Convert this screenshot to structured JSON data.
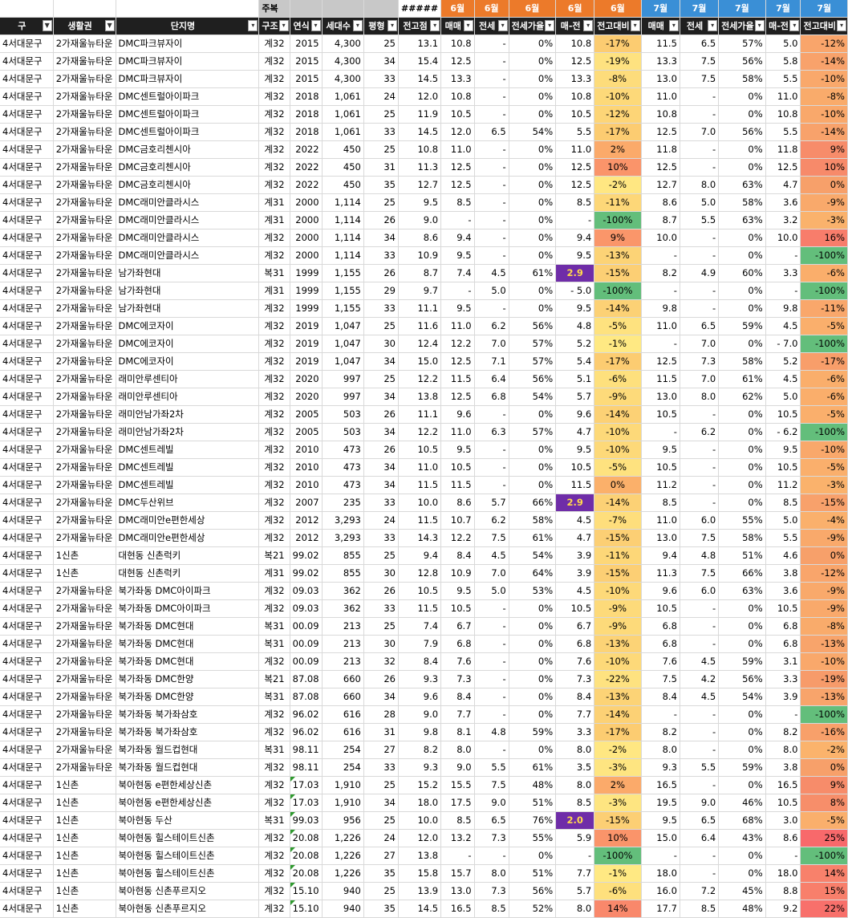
{
  "top_row": {
    "label": "주복",
    "hash": "#####",
    "months6": [
      "6월",
      "6월",
      "6월",
      "6월",
      "6월"
    ],
    "months7": [
      "7월",
      "7월",
      "7월",
      "7월",
      "7월"
    ]
  },
  "headers": [
    "구",
    "생활권",
    "단지명",
    "구조",
    "연식",
    "세대수",
    "평형",
    "전고점",
    "매매",
    "전세",
    "전세가율",
    "매-전",
    "전고대비",
    "매매",
    "전세",
    "전세가율",
    "매-전",
    "전고대비"
  ],
  "rows": [
    [
      "4서대문구",
      "2가재울뉴타운",
      "DMC파크뷰자이",
      "계32",
      "2015",
      "4,300",
      "25",
      "13.1",
      "10.8",
      "-",
      "0%",
      "10.8",
      "-17%",
      "11.5",
      "6.5",
      "57%",
      "5.0",
      "-12%"
    ],
    [
      "4서대문구",
      "2가재울뉴타운",
      "DMC파크뷰자이",
      "계32",
      "2015",
      "4,300",
      "34",
      "15.4",
      "12.5",
      "-",
      "0%",
      "12.5",
      "-19%",
      "13.3",
      "7.5",
      "56%",
      "5.8",
      "-14%"
    ],
    [
      "4서대문구",
      "2가재울뉴타운",
      "DMC파크뷰자이",
      "계32",
      "2015",
      "4,300",
      "33",
      "14.5",
      "13.3",
      "-",
      "0%",
      "13.3",
      "-8%",
      "13.0",
      "7.5",
      "58%",
      "5.5",
      "-10%"
    ],
    [
      "4서대문구",
      "2가재울뉴타운",
      "DMC센트럴아이파크",
      "계32",
      "2018",
      "1,061",
      "24",
      "12.0",
      "10.8",
      "-",
      "0%",
      "10.8",
      "-10%",
      "11.0",
      "-",
      "0%",
      "11.0",
      "-8%"
    ],
    [
      "4서대문구",
      "2가재울뉴타운",
      "DMC센트럴아이파크",
      "계32",
      "2018",
      "1,061",
      "25",
      "11.9",
      "10.5",
      "-",
      "0%",
      "10.5",
      "-12%",
      "10.8",
      "-",
      "0%",
      "10.8",
      "-10%"
    ],
    [
      "4서대문구",
      "2가재울뉴타운",
      "DMC센트럴아이파크",
      "계32",
      "2018",
      "1,061",
      "33",
      "14.5",
      "12.0",
      "6.5",
      "54%",
      "5.5",
      "-17%",
      "12.5",
      "7.0",
      "56%",
      "5.5",
      "-14%"
    ],
    [
      "4서대문구",
      "2가재울뉴타운",
      "DMC금호리첸시아",
      "계32",
      "2022",
      "450",
      "25",
      "10.8",
      "11.0",
      "-",
      "0%",
      "11.0",
      "2%",
      "11.8",
      "-",
      "0%",
      "11.8",
      "9%"
    ],
    [
      "4서대문구",
      "2가재울뉴타운",
      "DMC금호리첸시아",
      "계32",
      "2022",
      "450",
      "31",
      "11.3",
      "12.5",
      "-",
      "0%",
      "12.5",
      "10%",
      "12.5",
      "-",
      "0%",
      "12.5",
      "10%"
    ],
    [
      "4서대문구",
      "2가재울뉴타운",
      "DMC금호리첸시아",
      "계32",
      "2022",
      "450",
      "35",
      "12.7",
      "12.5",
      "-",
      "0%",
      "12.5",
      "-2%",
      "12.7",
      "8.0",
      "63%",
      "4.7",
      "0%"
    ],
    [
      "4서대문구",
      "2가재울뉴타운",
      "DMC래미안클라시스",
      "계31",
      "2000",
      "1,114",
      "25",
      "9.5",
      "8.5",
      "-",
      "0%",
      "8.5",
      "-11%",
      "8.6",
      "5.0",
      "58%",
      "3.6",
      "-9%"
    ],
    [
      "4서대문구",
      "2가재울뉴타운",
      "DMC래미안클라시스",
      "계31",
      "2000",
      "1,114",
      "26",
      "9.0",
      "-",
      "-",
      "0%",
      "-",
      "-100%",
      "8.7",
      "5.5",
      "63%",
      "3.2",
      "-3%"
    ],
    [
      "4서대문구",
      "2가재울뉴타운",
      "DMC래미안클라시스",
      "계32",
      "2000",
      "1,114",
      "34",
      "8.6",
      "9.4",
      "-",
      "0%",
      "9.4",
      "9%",
      "10.0",
      "-",
      "0%",
      "10.0",
      "16%"
    ],
    [
      "4서대문구",
      "2가재울뉴타운",
      "DMC래미안클라시스",
      "계32",
      "2000",
      "1,114",
      "33",
      "10.9",
      "9.5",
      "-",
      "0%",
      "9.5",
      "-13%",
      "-",
      "-",
      "0%",
      "-",
      "-100%"
    ],
    [
      "4서대문구",
      "2가재울뉴타운",
      "남가좌현대",
      "복31",
      "1999",
      "1,155",
      "26",
      "8.7",
      "7.4",
      "4.5",
      "61%",
      "2.9",
      "-15%",
      "8.2",
      "4.9",
      "60%",
      "3.3",
      "-6%"
    ],
    [
      "4서대문구",
      "2가재울뉴타운",
      "남가좌현대",
      "계31",
      "1999",
      "1,155",
      "29",
      "9.7",
      "-",
      "5.0",
      "0%",
      "-  5.0",
      "-100%",
      "-",
      "-",
      "0%",
      "-",
      "-100%"
    ],
    [
      "4서대문구",
      "2가재울뉴타운",
      "남가좌현대",
      "계32",
      "1999",
      "1,155",
      "33",
      "11.1",
      "9.5",
      "-",
      "0%",
      "9.5",
      "-14%",
      "9.8",
      "-",
      "0%",
      "9.8",
      "-11%"
    ],
    [
      "4서대문구",
      "2가재울뉴타운",
      "DMC에코자이",
      "계32",
      "2019",
      "1,047",
      "25",
      "11.6",
      "11.0",
      "6.2",
      "56%",
      "4.8",
      "-5%",
      "11.0",
      "6.5",
      "59%",
      "4.5",
      "-5%"
    ],
    [
      "4서대문구",
      "2가재울뉴타운",
      "DMC에코자이",
      "계32",
      "2019",
      "1,047",
      "30",
      "12.4",
      "12.2",
      "7.0",
      "57%",
      "5.2",
      "-1%",
      "-",
      "7.0",
      "0%",
      "-  7.0",
      "-100%"
    ],
    [
      "4서대문구",
      "2가재울뉴타운",
      "DMC에코자이",
      "계32",
      "2019",
      "1,047",
      "34",
      "15.0",
      "12.5",
      "7.1",
      "57%",
      "5.4",
      "-17%",
      "12.5",
      "7.3",
      "58%",
      "5.2",
      "-17%"
    ],
    [
      "4서대문구",
      "2가재울뉴타운",
      "래미안루센티아",
      "계32",
      "2020",
      "997",
      "25",
      "12.2",
      "11.5",
      "6.4",
      "56%",
      "5.1",
      "-6%",
      "11.5",
      "7.0",
      "61%",
      "4.5",
      "-6%"
    ],
    [
      "4서대문구",
      "2가재울뉴타운",
      "래미안루센티아",
      "계32",
      "2020",
      "997",
      "34",
      "13.8",
      "12.5",
      "6.8",
      "54%",
      "5.7",
      "-9%",
      "13.0",
      "8.0",
      "62%",
      "5.0",
      "-6%"
    ],
    [
      "4서대문구",
      "2가재울뉴타운",
      "래미안남가좌2차",
      "계32",
      "2005",
      "503",
      "26",
      "11.1",
      "9.6",
      "-",
      "0%",
      "9.6",
      "-14%",
      "10.5",
      "-",
      "0%",
      "10.5",
      "-5%"
    ],
    [
      "4서대문구",
      "2가재울뉴타운",
      "래미안남가좌2차",
      "계32",
      "2005",
      "503",
      "34",
      "12.2",
      "11.0",
      "6.3",
      "57%",
      "4.7",
      "-10%",
      "-",
      "6.2",
      "0%",
      "-  6.2",
      "-100%"
    ],
    [
      "4서대문구",
      "2가재울뉴타운",
      "DMC센트레빌",
      "계32",
      "2010",
      "473",
      "26",
      "10.5",
      "9.5",
      "-",
      "0%",
      "9.5",
      "-10%",
      "9.5",
      "-",
      "0%",
      "9.5",
      "-10%"
    ],
    [
      "4서대문구",
      "2가재울뉴타운",
      "DMC센트레빌",
      "계32",
      "2010",
      "473",
      "34",
      "11.0",
      "10.5",
      "-",
      "0%",
      "10.5",
      "-5%",
      "10.5",
      "-",
      "0%",
      "10.5",
      "-5%"
    ],
    [
      "4서대문구",
      "2가재울뉴타운",
      "DMC센트레빌",
      "계32",
      "2010",
      "473",
      "34",
      "11.5",
      "11.5",
      "-",
      "0%",
      "11.5",
      "0%",
      "11.2",
      "-",
      "0%",
      "11.2",
      "-3%"
    ],
    [
      "4서대문구",
      "2가재울뉴타운",
      "DMC두산위브",
      "계32",
      "2007",
      "235",
      "33",
      "10.0",
      "8.6",
      "5.7",
      "66%",
      "2.9",
      "-14%",
      "8.5",
      "-",
      "0%",
      "8.5",
      "-15%"
    ],
    [
      "4서대문구",
      "2가재울뉴타운",
      "DMC래미안e편한세상",
      "계32",
      "2012",
      "3,293",
      "24",
      "11.5",
      "10.7",
      "6.2",
      "58%",
      "4.5",
      "-7%",
      "11.0",
      "6.0",
      "55%",
      "5.0",
      "-4%"
    ],
    [
      "4서대문구",
      "2가재울뉴타운",
      "DMC래미안e편한세상",
      "계32",
      "2012",
      "3,293",
      "33",
      "14.3",
      "12.2",
      "7.5",
      "61%",
      "4.7",
      "-15%",
      "13.0",
      "7.5",
      "58%",
      "5.5",
      "-9%"
    ],
    [
      "4서대문구",
      "1신촌",
      "대현동 신촌럭키",
      "복21",
      "99.02",
      "855",
      "25",
      "9.4",
      "8.4",
      "4.5",
      "54%",
      "3.9",
      "-11%",
      "9.4",
      "4.8",
      "51%",
      "4.6",
      "0%"
    ],
    [
      "4서대문구",
      "1신촌",
      "대현동 신촌럭키",
      "계31",
      "99.02",
      "855",
      "30",
      "12.8",
      "10.9",
      "7.0",
      "64%",
      "3.9",
      "-15%",
      "11.3",
      "7.5",
      "66%",
      "3.8",
      "-12%"
    ],
    [
      "4서대문구",
      "2가재울뉴타운",
      "북가좌동 DMC아이파크",
      "계32",
      "09.03",
      "362",
      "26",
      "10.5",
      "9.5",
      "5.0",
      "53%",
      "4.5",
      "-10%",
      "9.6",
      "6.0",
      "63%",
      "3.6",
      "-9%"
    ],
    [
      "4서대문구",
      "2가재울뉴타운",
      "북가좌동 DMC아이파크",
      "계32",
      "09.03",
      "362",
      "33",
      "11.5",
      "10.5",
      "-",
      "0%",
      "10.5",
      "-9%",
      "10.5",
      "-",
      "0%",
      "10.5",
      "-9%"
    ],
    [
      "4서대문구",
      "2가재울뉴타운",
      "북가좌동 DMC현대",
      "복31",
      "00.09",
      "213",
      "25",
      "7.4",
      "6.7",
      "-",
      "0%",
      "6.7",
      "-9%",
      "6.8",
      "-",
      "0%",
      "6.8",
      "-8%"
    ],
    [
      "4서대문구",
      "2가재울뉴타운",
      "북가좌동 DMC현대",
      "복31",
      "00.09",
      "213",
      "30",
      "7.9",
      "6.8",
      "-",
      "0%",
      "6.8",
      "-13%",
      "6.8",
      "-",
      "0%",
      "6.8",
      "-13%"
    ],
    [
      "4서대문구",
      "2가재울뉴타운",
      "북가좌동 DMC현대",
      "계32",
      "00.09",
      "213",
      "32",
      "8.4",
      "7.6",
      "-",
      "0%",
      "7.6",
      "-10%",
      "7.6",
      "4.5",
      "59%",
      "3.1",
      "-10%"
    ],
    [
      "4서대문구",
      "2가재울뉴타운",
      "북가좌동 DMC한양",
      "복21",
      "87.08",
      "660",
      "26",
      "9.3",
      "7.3",
      "-",
      "0%",
      "7.3",
      "-22%",
      "7.5",
      "4.2",
      "56%",
      "3.3",
      "-19%"
    ],
    [
      "4서대문구",
      "2가재울뉴타운",
      "북가좌동 DMC한양",
      "복31",
      "87.08",
      "660",
      "34",
      "9.6",
      "8.4",
      "-",
      "0%",
      "8.4",
      "-13%",
      "8.4",
      "4.5",
      "54%",
      "3.9",
      "-13%"
    ],
    [
      "4서대문구",
      "2가재울뉴타운",
      "북가좌동 북가좌삼호",
      "계32",
      "96.02",
      "616",
      "28",
      "9.0",
      "7.7",
      "-",
      "0%",
      "7.7",
      "-14%",
      "-",
      "-",
      "0%",
      "-",
      "-100%"
    ],
    [
      "4서대문구",
      "2가재울뉴타운",
      "북가좌동 북가좌삼호",
      "계32",
      "96.02",
      "616",
      "31",
      "9.8",
      "8.1",
      "4.8",
      "59%",
      "3.3",
      "-17%",
      "8.2",
      "-",
      "0%",
      "8.2",
      "-16%"
    ],
    [
      "4서대문구",
      "2가재울뉴타운",
      "북가좌동 월드컵현대",
      "복31",
      "98.11",
      "254",
      "27",
      "8.2",
      "8.0",
      "-",
      "0%",
      "8.0",
      "-2%",
      "8.0",
      "-",
      "0%",
      "8.0",
      "-2%"
    ],
    [
      "4서대문구",
      "2가재울뉴타운",
      "북가좌동 월드컵현대",
      "계32",
      "98.11",
      "254",
      "33",
      "9.3",
      "9.0",
      "5.5",
      "61%",
      "3.5",
      "-3%",
      "9.3",
      "5.5",
      "59%",
      "3.8",
      "0%"
    ],
    [
      "4서대문구",
      "1신촌",
      "북아현동 e편한세상신촌",
      "계32",
      "17.03",
      "1,910",
      "25",
      "15.2",
      "15.5",
      "7.5",
      "48%",
      "8.0",
      "2%",
      "16.5",
      "-",
      "0%",
      "16.5",
      "9%"
    ],
    [
      "4서대문구",
      "1신촌",
      "북아현동 e편한세상신촌",
      "계32",
      "17.03",
      "1,910",
      "34",
      "18.0",
      "17.5",
      "9.0",
      "51%",
      "8.5",
      "-3%",
      "19.5",
      "9.0",
      "46%",
      "10.5",
      "8%"
    ],
    [
      "4서대문구",
      "1신촌",
      "북아현동 두산",
      "복31",
      "99.03",
      "956",
      "25",
      "10.0",
      "8.5",
      "6.5",
      "76%",
      "2.0",
      "-15%",
      "9.5",
      "6.5",
      "68%",
      "3.0",
      "-5%"
    ],
    [
      "4서대문구",
      "1신촌",
      "북아현동 힐스테이트신촌",
      "계32",
      "20.08",
      "1,226",
      "24",
      "12.0",
      "13.2",
      "7.3",
      "55%",
      "5.9",
      "10%",
      "15.0",
      "6.4",
      "43%",
      "8.6",
      "25%"
    ],
    [
      "4서대문구",
      "1신촌",
      "북아현동 힐스테이트신촌",
      "계32",
      "20.08",
      "1,226",
      "27",
      "13.8",
      "-",
      "-",
      "0%",
      "-",
      "-100%",
      "-",
      "-",
      "0%",
      "-",
      "-100%"
    ],
    [
      "4서대문구",
      "1신촌",
      "북아현동 힐스테이트신촌",
      "계32",
      "20.08",
      "1,226",
      "35",
      "15.8",
      "15.7",
      "8.0",
      "51%",
      "7.7",
      "-1%",
      "18.0",
      "-",
      "0%",
      "18.0",
      "14%"
    ],
    [
      "4서대문구",
      "1신촌",
      "북아현동 신촌푸르지오",
      "계32",
      "15.10",
      "940",
      "25",
      "13.9",
      "13.0",
      "7.3",
      "56%",
      "5.7",
      "-6%",
      "16.0",
      "7.2",
      "45%",
      "8.8",
      "15%"
    ],
    [
      "4서대문구",
      "1신촌",
      "북아현동 신촌푸르지오",
      "계32",
      "15.10",
      "940",
      "35",
      "14.5",
      "16.5",
      "8.5",
      "52%",
      "8.0",
      "14%",
      "17.7",
      "8.5",
      "48%",
      "9.2",
      "22%"
    ]
  ],
  "highlight_cells": [
    [
      13,
      11
    ],
    [
      26,
      11
    ],
    [
      44,
      11
    ]
  ],
  "triangle_rows": [
    42,
    43,
    44,
    45,
    46,
    47,
    48,
    49
  ],
  "colors": {
    "header_bg": "#1f1f1f",
    "june_header": "#ec7a2a",
    "july_header": "#3a8fd6",
    "highlight_bg": "#6f2da8",
    "highlight_text": "#ffd84d",
    "scale_low": "#63be7b",
    "scale_mid": "#ffeb84",
    "scale_high": "#f8696b"
  }
}
